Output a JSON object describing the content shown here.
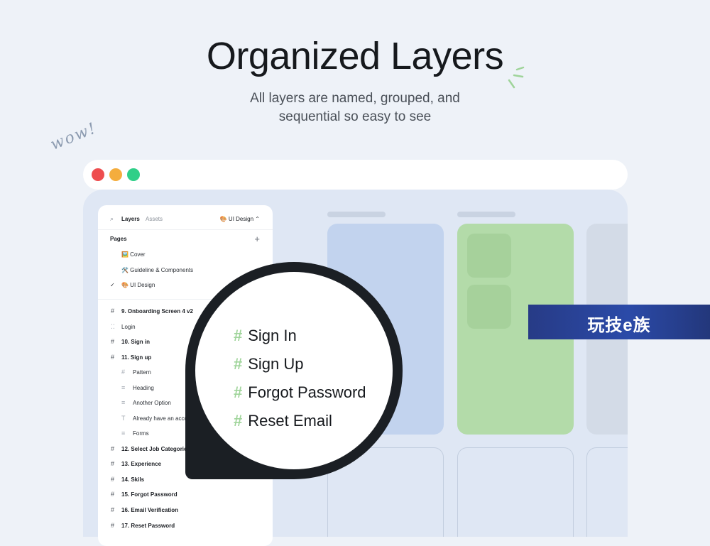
{
  "header": {
    "title": "Organized Layers",
    "subtitle_line1": "All layers are named, grouped, and",
    "subtitle_line2": "sequential so easy to see",
    "doodle": "wow!"
  },
  "colors": {
    "background": "#eef2f8",
    "close": "#ee4d4f",
    "minimize": "#f4ad3d",
    "maximize": "#2fcf88",
    "card_blue": "#c2d3ee",
    "card_green": "#b3dba9",
    "hash_accent": "#9fd49a"
  },
  "panel": {
    "search_icon": "search-icon",
    "tab_layers": "Layers",
    "tab_assets": "Assets",
    "current_page": "🎨 UI Design",
    "page_chevron": "⌃",
    "pages_label": "Pages",
    "add_icon": "+",
    "pages": [
      {
        "label": "🖼️ Cover"
      },
      {
        "label": "🛠️ Guideline & Components"
      },
      {
        "label": "🎨 UI Design",
        "checked": true
      }
    ],
    "layers": [
      {
        "label": "9. Onboarding Screen 4 v2"
      },
      {
        "label": "Login"
      },
      {
        "label": "10. Sign in"
      },
      {
        "label": "11. Sign up"
      },
      {
        "label": "Pattern"
      },
      {
        "label": "Heading"
      },
      {
        "label": "Another Option"
      },
      {
        "label": "Already have an acco"
      },
      {
        "label": "Forms"
      },
      {
        "label": "12. Select Job Categories"
      },
      {
        "label": "13. Experience"
      },
      {
        "label": "14. Skils"
      },
      {
        "label": "15. Forgot Password"
      },
      {
        "label": "16. Email Verification"
      },
      {
        "label": "17. Reset Password"
      }
    ]
  },
  "magnifier": {
    "items": [
      "Sign In",
      "Sign Up",
      "Forgot Password",
      "Reset Email"
    ]
  },
  "watermark": "玩技e族"
}
